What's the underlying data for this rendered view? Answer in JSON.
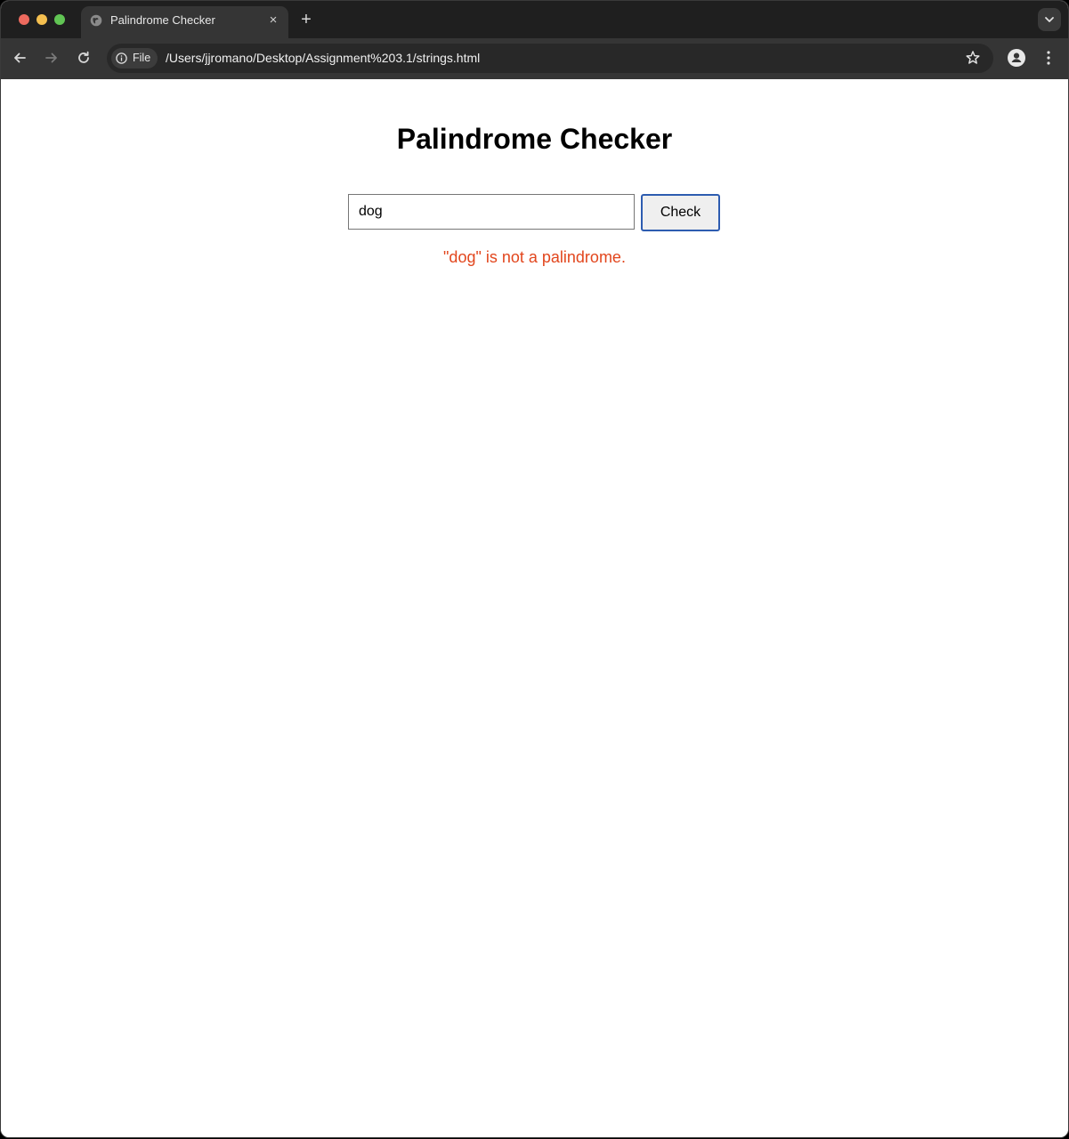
{
  "browser": {
    "tab_title": "Palindrome Checker",
    "tab_close": "×",
    "new_tab": "+",
    "security_chip_label": "File",
    "url": "/Users/jjromano/Desktop/Assignment%203.1/strings.html"
  },
  "page": {
    "heading": "Palindrome Checker",
    "input_value": "dog",
    "check_button_label": "Check",
    "result_text": "\"dog\" is not a palindrome.",
    "result_color": "#e2461d"
  },
  "icons": {
    "back": "back-arrow-icon",
    "forward": "forward-arrow-icon",
    "reload": "reload-icon",
    "info": "info-icon",
    "bookmark": "star-icon",
    "profile": "profile-icon",
    "menu": "kebab-menu-icon",
    "tab_search": "chevron-down-icon",
    "favicon": "globe-icon"
  }
}
